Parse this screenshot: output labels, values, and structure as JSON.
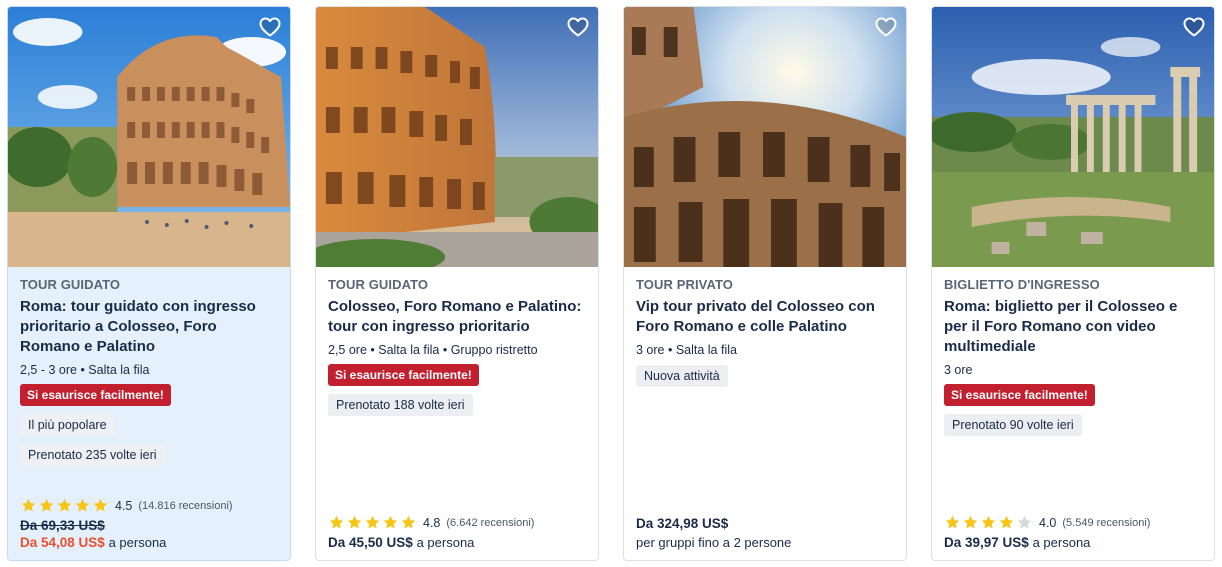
{
  "colors": {
    "accent_red": "#c2202f",
    "sale": "#e8502e",
    "text": "#1a2b49",
    "highlight_bg": "#e4f0fc",
    "star": "#f5c518"
  },
  "cards": [
    {
      "category": "TOUR GUIDATO",
      "title": "Roma: tour guidato con ingresso prioritario a Colosseo, Foro Romano e Palatino",
      "meta": "2,5 - 3 ore • Salta la fila",
      "badge_red": "Si esaurisce facilmente!",
      "badge_1": "Il più popolare",
      "badge_2": "Prenotato 235 volte ieri",
      "rating": "4.5",
      "stars": 5,
      "reviews": "(14.816 recensioni)",
      "old_price": "Da 69,33 US$",
      "price": "Da 54,08 US$",
      "price_unit": "a persona",
      "image_icon": "colosseum-photo"
    },
    {
      "category": "TOUR GUIDATO",
      "title": "Colosseo, Foro Romano e Palatino: tour con ingresso prioritario",
      "meta": "2,5 ore • Salta la fila • Gruppo ristretto",
      "badge_red": "Si esaurisce facilmente!",
      "badge_1": "Prenotato 188 volte ieri",
      "rating": "4.8",
      "stars": 5,
      "reviews": "(6.642 recensioni)",
      "price": "Da 45,50 US$",
      "price_unit": "a persona",
      "image_icon": "colosseum-sunset-photo"
    },
    {
      "category": "TOUR PRIVATO",
      "title": "Vip tour privato del Colosseo con Foro Romano e colle Palatino",
      "meta": "3 ore • Salta la fila",
      "badge_1": "Nuova attività",
      "price": "Da 324,98 US$",
      "group_text": "per gruppi fino a 2 persone",
      "image_icon": "colosseum-closeup-photo"
    },
    {
      "category": "BIGLIETTO D'INGRESSO",
      "title": "Roma: biglietto per il Colosseo e per il Foro Romano con video multimediale",
      "meta": "3 ore",
      "badge_red": "Si esaurisce facilmente!",
      "badge_1": "Prenotato 90 volte ieri",
      "rating": "4.0",
      "stars": 4,
      "reviews": "(5.549 recensioni)",
      "price": "Da 39,97 US$",
      "price_unit": "a persona",
      "image_icon": "roman-forum-photo"
    }
  ]
}
